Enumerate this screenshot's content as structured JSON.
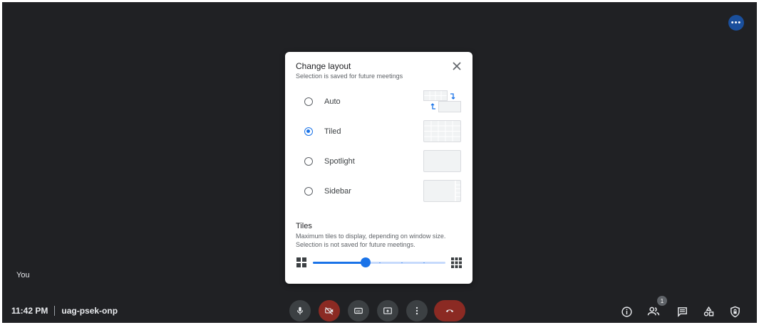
{
  "meeting": {
    "self_name": "You",
    "time": "11:42 PM",
    "code": "uag-psek-onp",
    "participant_count": "1"
  },
  "dialog": {
    "title": "Change layout",
    "subtitle": "Selection is saved for future meetings",
    "options": [
      {
        "label": "Auto",
        "checked": false
      },
      {
        "label": "Tiled",
        "checked": true
      },
      {
        "label": "Spotlight",
        "checked": false
      },
      {
        "label": "Sidebar",
        "checked": false
      }
    ],
    "tiles": {
      "title": "Tiles",
      "desc_line1": "Maximum tiles to display, depending on window size.",
      "desc_line2": "Selection is not saved for future meetings.",
      "slider_fraction": 0.4,
      "slider_steps": 6
    }
  },
  "icons": {
    "more": "more-options-icon",
    "close": "close-icon",
    "mic": "microphone-icon",
    "camera_off": "camera-off-icon",
    "captions": "captions-icon",
    "present": "present-screen-icon",
    "more_vert": "more-vertical-icon",
    "end_call": "end-call-icon",
    "info": "info-icon",
    "people": "people-icon",
    "chat": "chat-icon",
    "activities": "activities-icon",
    "host_controls": "host-controls-icon"
  },
  "colors": {
    "background": "#202124",
    "accent": "#1a73e8",
    "end_call": "#8b2a23"
  }
}
